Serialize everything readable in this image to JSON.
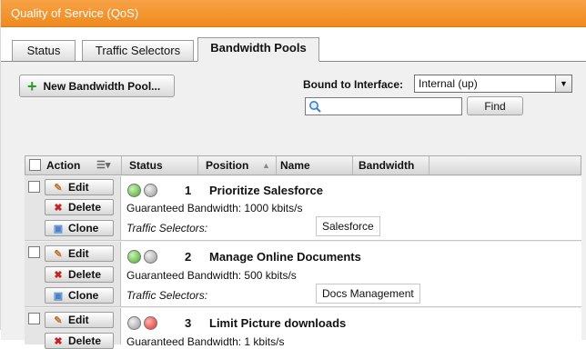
{
  "window": {
    "title": "Quality of Service (QoS)"
  },
  "tabs": [
    {
      "label": "Status",
      "active": false
    },
    {
      "label": "Traffic Selectors",
      "active": false
    },
    {
      "label": "Bandwidth Pools",
      "active": true
    }
  ],
  "toolbar": {
    "new_pool_label": "New Bandwidth Pool...",
    "bound_label": "Bound to Interface:",
    "interface_value": "Internal (up)",
    "search_value": "",
    "find_label": "Find"
  },
  "grid": {
    "columns": [
      "Action",
      "Status",
      "Position",
      "Name",
      "Bandwidth"
    ]
  },
  "actions": {
    "edit": "Edit",
    "delete": "Delete",
    "clone": "Clone"
  },
  "ts_label": "Traffic Selectors:",
  "rows": [
    {
      "position": "1",
      "name": "Prioritize Salesforce",
      "bandwidth": "Guaranteed Bandwidth: 1000 kbits/s",
      "selector": "Salesforce",
      "status": [
        "green",
        "gray"
      ]
    },
    {
      "position": "2",
      "name": "Manage Online Documents",
      "bandwidth": "Guaranteed Bandwidth: 500 kbits/s",
      "selector": "Docs Management",
      "status": [
        "green",
        "gray"
      ]
    },
    {
      "position": "3",
      "name": "Limit Picture downloads",
      "bandwidth": "Guaranteed Bandwidth: 1 kbits/s",
      "selector": "",
      "status": [
        "gray",
        "red"
      ]
    }
  ],
  "colors": {
    "titlebar": "#ef8a1f",
    "status_on": "#4aa628",
    "status_block": "#e32a2a"
  }
}
